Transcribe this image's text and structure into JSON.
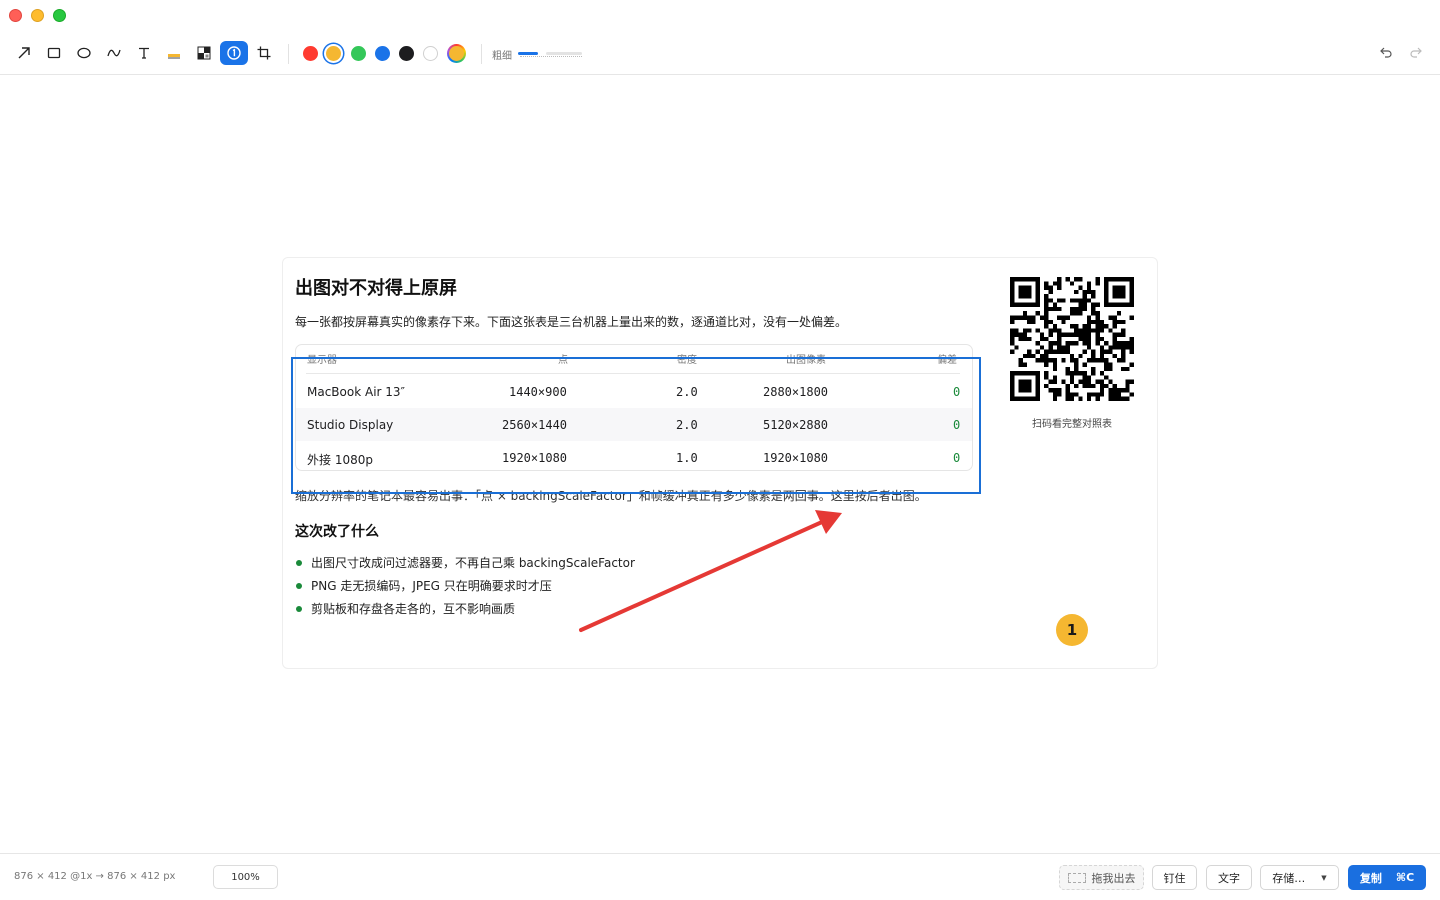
{
  "colors": {
    "accent": "#1a73e8",
    "annotation_rect": "#1a6fd6",
    "annotation_arrow": "#e53935",
    "badge": "#f5b731",
    "status_green": "#1a8a3a"
  },
  "toolbar": {
    "tools": [
      "arrow-tool-icon",
      "rectangle-tool-icon",
      "ellipse-tool-icon",
      "freehand-tool-icon",
      "text-tool-icon",
      "highlighter-tool-icon",
      "mosaic-tool-icon",
      "counter-tool-icon",
      "crop-tool-icon"
    ],
    "active_tool": "counter-tool-icon",
    "swatches": [
      "#ff3b30",
      "#f5b731",
      "#34c759",
      "#1a73e8",
      "#1d1d1f",
      "#ffffff"
    ],
    "selected_swatch": "#f5b731",
    "thickness_label": "粗细"
  },
  "card": {
    "title": "出图对不对得上原屏",
    "description": "每一张都按屏幕真实的像素存下来。下面这张表是三台机器上量出来的数，逐通道比对，没有一处偏差。",
    "table": {
      "headers": [
        "显示器",
        "点",
        "密度",
        "出图像素",
        "偏差"
      ],
      "rows": [
        [
          "MacBook Air 13″",
          "1440×900",
          "2.0",
          "2880×1800",
          "0"
        ],
        [
          "Studio Display",
          "2560×1440",
          "2.0",
          "5120×2880",
          "0"
        ],
        [
          "外接 1080p",
          "1920×1080",
          "1.0",
          "1920×1080",
          "0"
        ]
      ]
    },
    "note": "缩放分辨率的笔记本最容易出事：「点 × backingScaleFactor」和帧缓冲真正有多少像素是两回事。这里按后者出图。",
    "section_title": "这次改了什么",
    "bullets": [
      "出图尺寸改成问过滤器要，不再自己乘 backingScaleFactor",
      "PNG 走无损编码，JPEG 只在明确要求时才压",
      "剪贴板和存盘各走各的，互不影响画质"
    ],
    "qr_caption": "扫码看完整对照表"
  },
  "annotations": {
    "counter_label": "1"
  },
  "bottom": {
    "dimensions": "876 × 412 @1x  →  876 × 412 px",
    "zoom": "100%",
    "drag_label": "拖我出去",
    "pin_label": "钉住",
    "text_label": "文字",
    "save_label": "存储…",
    "copy_label": "复制",
    "copy_shortcut": "⌘C"
  }
}
